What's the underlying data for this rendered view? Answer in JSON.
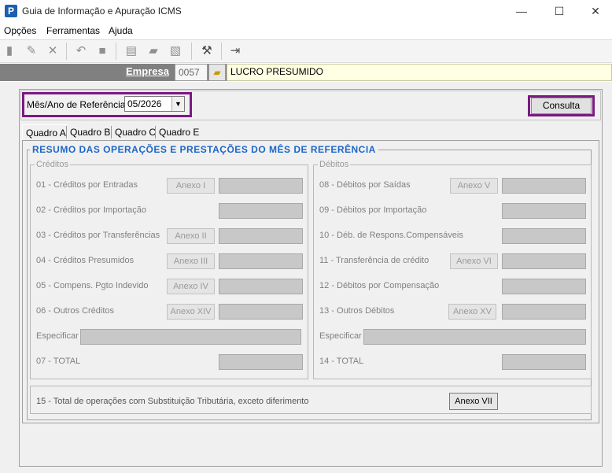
{
  "window": {
    "title": "Guia de Informação e Apuração ICMS",
    "icon_letter": "P",
    "minimize": "—",
    "maximize": "☐",
    "close": "✕"
  },
  "menu": [
    "Opções",
    "Ferramentas",
    "Ajuda"
  ],
  "empresa": {
    "label": "Empresa",
    "code": "0057",
    "name": "LUCRO PRESUMIDO"
  },
  "reference": {
    "label": "Mês/Ano de Referência",
    "value": "05/2026",
    "consulta_label": "Consulta"
  },
  "tabs": [
    "Quadro A",
    "Quadro B",
    "Quadro C",
    "Quadro E"
  ],
  "section_title": "RESUMO DAS OPERAÇÕES E PRESTAÇÕES DO MÊS DE REFERÊNCIA",
  "creditos": {
    "title": "Créditos",
    "rows": [
      {
        "label": "01 - Créditos por Entradas",
        "annex": "Anexo I"
      },
      {
        "label": "02 - Créditos por Importação",
        "annex": ""
      },
      {
        "label": "03 - Créditos por Transferências",
        "annex": "Anexo II"
      },
      {
        "label": "04 - Créditos Presumidos",
        "annex": "Anexo III"
      },
      {
        "label": "05 - Compens. Pgto Indevido",
        "annex": "Anexo IV"
      },
      {
        "label": "06 - Outros Créditos",
        "annex": "Anexo XIV"
      }
    ],
    "especificar": "Especificar",
    "total": "07 - TOTAL"
  },
  "debitos": {
    "title": "Débitos",
    "rows": [
      {
        "label": "08 - Débitos por Saídas",
        "annex": "Anexo V"
      },
      {
        "label": "09 - Débitos por Importação",
        "annex": ""
      },
      {
        "label": "10 - Déb. de Respons.Compensáveis",
        "annex": ""
      },
      {
        "label": "11 - Transferência de crédito",
        "annex": "Anexo VI"
      },
      {
        "label": "12 - Débitos por Compensação",
        "annex": ""
      },
      {
        "label": "13 - Outros Débitos",
        "annex": "Anexo XV"
      }
    ],
    "especificar": "Especificar",
    "total": "14 - TOTAL"
  },
  "substituicao": {
    "label": "15 - Total  de operações com Substituição Tributária, exceto diferimento",
    "annex": "Anexo VII"
  },
  "toolbar_icons": [
    "new-icon",
    "edit-icon",
    "delete-icon",
    "undo-icon",
    "stop-icon",
    "doc-icon",
    "print-icon",
    "export-icon",
    "tools-icon",
    "exit-icon"
  ]
}
